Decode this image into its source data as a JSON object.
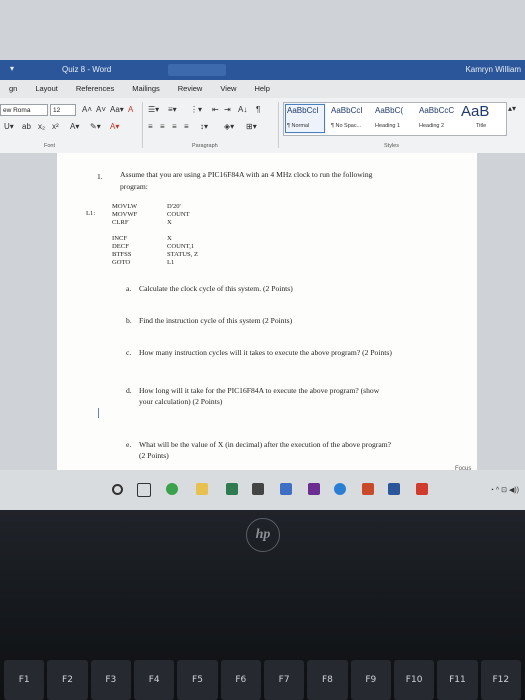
{
  "titlebar": {
    "title": "Quiz 8 - Word",
    "user": "Kamryn William",
    "search_placeholder": ""
  },
  "tabs": [
    "gn",
    "Layout",
    "References",
    "Mailings",
    "Review",
    "View",
    "Help"
  ],
  "ribbon": {
    "font_name": "ew Roma",
    "font_size": "12",
    "group_font": "Font",
    "group_paragraph": "Paragraph",
    "group_styles": "Styles",
    "styles": [
      {
        "sample": "AaBbCcI",
        "name": "¶ Normal",
        "selected": true
      },
      {
        "sample": "AaBbCcI",
        "name": "¶ No Spac...",
        "selected": false
      },
      {
        "sample": "AaBbC(",
        "name": "Heading 1",
        "selected": false
      },
      {
        "sample": "AaBbCcC",
        "name": "Heading 2",
        "selected": false
      },
      {
        "sample": "AaB",
        "name": "Title",
        "selected": false
      }
    ]
  },
  "document": {
    "q_number": "1.",
    "q_text_1": "Assume that you are using a PIC16F84A with an 4 MHz clock to run the following",
    "q_text_2": "program:",
    "code": [
      {
        "label": "",
        "op": "MOVLW",
        "arg": "D'20'"
      },
      {
        "label": "",
        "op": "MOVWF",
        "arg": "COUNT"
      },
      {
        "label": "",
        "op": "CLRF",
        "arg": "X"
      },
      {
        "label": "L1:",
        "op": "INCF",
        "arg": "X"
      },
      {
        "label": "",
        "op": "DECF",
        "arg": "COUNT,1"
      },
      {
        "label": "",
        "op": "BTFSS",
        "arg": "STATUS, Z"
      },
      {
        "label": "",
        "op": "GOTO",
        "arg": "L1"
      }
    ],
    "parts": [
      {
        "letter": "a.",
        "lines": [
          "Calculate the clock cycle of this system. (2 Points)"
        ]
      },
      {
        "letter": "b.",
        "lines": [
          "Find the instruction cycle of this system (2 Points)"
        ]
      },
      {
        "letter": "c.",
        "lines": [
          "How many instruction cycles will it takes to execute the above program? (2 Points)"
        ]
      },
      {
        "letter": "d.",
        "lines": [
          "How long will it take for the PIC16F84A to execute the above program? (show",
          "your calculation) (2 Points)"
        ]
      },
      {
        "letter": "e.",
        "lines": [
          "What will be the value of X (in decimal) after the execution of the above program?",
          "(2 Points)"
        ]
      }
    ]
  },
  "status": {
    "focus": "Focus"
  },
  "keyboard": [
    "F1",
    "F2",
    "F3",
    "F4",
    "F5",
    "F6",
    "F7",
    "F8",
    "F9",
    "F10",
    "F11",
    "F12"
  ],
  "colors": {
    "titlebar": "#2b579a",
    "ribbon": "#f1f2f3",
    "page": "#fdfdfb"
  }
}
